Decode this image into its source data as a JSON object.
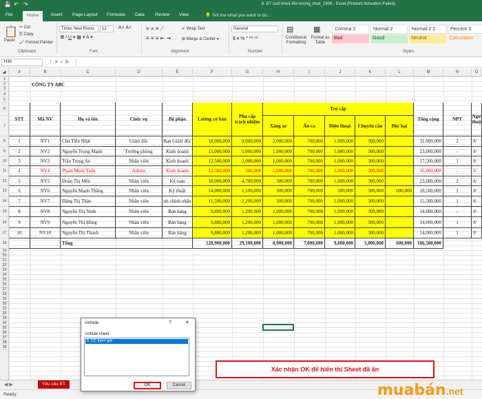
{
  "titlebar": {
    "title": "6. BT cuối khoá tiền lương_thué_1908 - Excel (Product Activation Failed)",
    "save_icon": "save-icon",
    "undo_icon": "undo-icon",
    "redo_icon": "redo-icon"
  },
  "tabs": [
    "File",
    "Home",
    "Insert",
    "Page Layout",
    "Formulas",
    "Data",
    "Review",
    "View"
  ],
  "tellme": "Tell me what you want to do...",
  "ribbon": {
    "paste": "Paste",
    "cut": "Cut",
    "copy": "Copy",
    "format_painter": "Format Painter",
    "clipboard": "Clipboard",
    "font_name": "Times New Roma",
    "font_size": "12",
    "font": "Font",
    "wrap_text": "Wrap Text",
    "merge_center": "Merge & Center",
    "alignment": "Alignment",
    "number_format": "General",
    "number": "Number",
    "conditional": "Conditional Formatting",
    "format_as_table": "Format as Table",
    "styles": "Styles",
    "style_cells": [
      {
        "label": "Comma 2",
        "bg": "#ffffff",
        "fg": "#333333"
      },
      {
        "label": "Normal 2",
        "bg": "#ffffff",
        "fg": "#333333"
      },
      {
        "label": "Normal 2 2",
        "bg": "#ffffff",
        "fg": "#333333"
      },
      {
        "label": "Percent 3",
        "bg": "#ffffff",
        "fg": "#333333"
      },
      {
        "label": "Bad",
        "bg": "#ffc7ce",
        "fg": "#9c0006"
      },
      {
        "label": "Good",
        "bg": "#c6efce",
        "fg": "#006100"
      },
      {
        "label": "Neutral",
        "bg": "#ffeb9c",
        "fg": "#9c5700"
      },
      {
        "label": "Calculation",
        "bg": "#f2f2f2",
        "fg": "#fa7d00"
      }
    ]
  },
  "namebox": "H30",
  "fx": "fx",
  "columns": [
    "A",
    "B",
    "C",
    "D",
    "E",
    "F",
    "G",
    "H",
    "I",
    "J",
    "K",
    "L",
    "M",
    "N",
    "O"
  ],
  "rows": [
    "1",
    "2",
    "3",
    "4",
    "5",
    "6",
    "7",
    "8",
    "9",
    "10",
    "11",
    "12",
    "13",
    "14",
    "15",
    "16",
    "17",
    "18",
    "19",
    "20",
    "21",
    "22",
    "23",
    "24",
    "25",
    "26",
    "27",
    "28",
    "29",
    "30",
    "31",
    "32",
    "33",
    "34",
    "35",
    "36",
    "37",
    "38",
    "39"
  ],
  "company": "CÔNG TY ABC",
  "headers": {
    "stt": "STT",
    "ma": "Mã NV",
    "ten": "Họ và tên",
    "cv": "Chức vụ",
    "bp": "Bộ phận",
    "luong": "Lương cơ bản",
    "pccn": "Phụ cấp trách nhiệm",
    "trocap": "Trợ cấp",
    "xe": "Xăng xe",
    "anca": "Ăn ca",
    "dt": "Điện thoại",
    "cc": "Chuyên cần",
    "dh": "Độc hại",
    "tong": "Tổng cộng",
    "npt": "NPT",
    "ng": "Ngư thuộ"
  },
  "employees": [
    {
      "stt": "1",
      "ma": "NV1",
      "ten": "Chu Tiến Nhật",
      "cv": "Giám đốc",
      "bp": "Ban Giám đốc",
      "luong": "18,000,000",
      "pc": "9,000,000",
      "xe": "2,000,000",
      "an": "700,000",
      "dt": "1,000,000",
      "cc": "300,000",
      "dh": "",
      "tong": "31,000,000",
      "npt": "2",
      "o": "#/"
    },
    {
      "stt": "2",
      "ma": "NV2",
      "ten": "Nguyễn Trọng Mạnh",
      "cv": "Trưởng phòng",
      "bp": "Kinh doanh",
      "luong": "15,000,000",
      "pc": "5,000,000",
      "xe": "1,000,000",
      "an": "700,000",
      "dt": "1,000,000",
      "cc": "300,000",
      "dh": "",
      "tong": "23,000,000",
      "npt": "-",
      "o": "#/"
    },
    {
      "stt": "3",
      "ma": "NV3",
      "ten": "Trần Trung An",
      "cv": "Nhân viên",
      "bp": "Kinh doanh",
      "luong": "12,500,000",
      "pc": "2,000,000",
      "xe": "1,000,000",
      "an": "700,000",
      "dt": "1,000,000",
      "cc": "300,000",
      "dh": "",
      "tong": "17,500,000",
      "npt": "1",
      "o": "#/"
    },
    {
      "stt": "4",
      "ma": "NV4",
      "ten": "Phạm Minh Tuấn",
      "cv": "Admin",
      "bp": "Kinh doanh",
      "luong": "12,500,000",
      "pc": "500,000",
      "xe": "1,000,000",
      "an": "700,000",
      "dt": "1,000,000",
      "cc": "300,000",
      "dh": "",
      "tong": "16,000,000",
      "npt": "-",
      "o": "#/",
      "red": true
    },
    {
      "stt": "5",
      "ma": "NV5",
      "ten": "Đoàn Thị Mến",
      "cv": "Nhân viên",
      "bp": "Kế toán",
      "luong": "16,000,000",
      "pc": "4,700,000",
      "xe": "300,000",
      "an": "700,000",
      "dt": "1,000,000",
      "cc": "300,000",
      "dh": "",
      "tong": "23,000,000",
      "npt": "2",
      "o": "#/"
    },
    {
      "stt": "6",
      "ma": "NV6",
      "ten": "Nguyễn Mạnh Thắng",
      "cv": "Nhân viên",
      "bp": "Kỹ thuật",
      "luong": "14,000,000",
      "pc": "2,100,000",
      "xe": "300,000",
      "an": "700,000",
      "dt": "500,000",
      "cc": "300,000",
      "dh": "600,000",
      "tong": "18,500,000",
      "npt": "1",
      "o": "#/"
    },
    {
      "stt": "7",
      "ma": "NV7",
      "ten": "Đặng Thị Thảo",
      "cv": "Nhân viên",
      "bp": "nh chính nhân",
      "luong": "11,500,000",
      "pc": "2,200,000",
      "xe": "300,000",
      "an": "700,000",
      "dt": "1,000,000",
      "cc": "300,000",
      "dh": "",
      "tong": "15,500,000",
      "npt": "1",
      "o": "#/"
    },
    {
      "stt": "8",
      "ma": "NV8",
      "ten": "Nguyễn Thị Ninh",
      "cv": "Nhân viên",
      "bp": "Bán hàng",
      "luong": "9,800,000",
      "pc": "1,200,000",
      "xe": "1,000,000",
      "an": "700,000",
      "dt": "1,000,000",
      "cc": "300,000",
      "dh": "",
      "tong": "14,000,000",
      "npt": "-",
      "o": "#/"
    },
    {
      "stt": "9",
      "ma": "NV9",
      "ten": "Nguyễn Thị Hồng",
      "cv": "Nhân viên",
      "bp": "Bán hàng",
      "luong": "9,800,000",
      "pc": "1,200,000",
      "xe": "1,000,000",
      "an": "700,000",
      "dt": "1,000,000",
      "cc": "300,000",
      "dh": "",
      "tong": "14,000,000",
      "npt": "1",
      "o": "#/"
    },
    {
      "stt": "10",
      "ma": "NV10",
      "ten": "Nguyễn Thị Thanh",
      "cv": "Nhân viên",
      "bp": "Bán hàng",
      "luong": "9,800,000",
      "pc": "1,200,000",
      "xe": "1,000,000",
      "an": "700,000",
      "dt": "1,000,000",
      "cc": "300,000",
      "dh": "",
      "tong": "14,000,000",
      "npt": "1",
      "o": "#/"
    }
  ],
  "totals": {
    "label": "Tổng",
    "luong": "128,900,000",
    "pc": "29,100,000",
    "xe": "8,900,000",
    "an": "7,000,000",
    "dt": "9,000,000",
    "cc": "3,000,000",
    "dh": "600,000",
    "tong": "186,500,000"
  },
  "sheet_tab": "Yêu cầu BT",
  "status": "Ready",
  "dialog": {
    "title": "Unhide",
    "question": "?",
    "close": "✕",
    "label": "Unhide sheet:",
    "item": "5. CC thêm giờ",
    "ok": "OK",
    "cancel": "Cancel"
  },
  "callout": "Xác nhận OK để hiển thị Sheet đã ẩn",
  "logo": {
    "main": "muabán",
    "tld": ".net"
  }
}
